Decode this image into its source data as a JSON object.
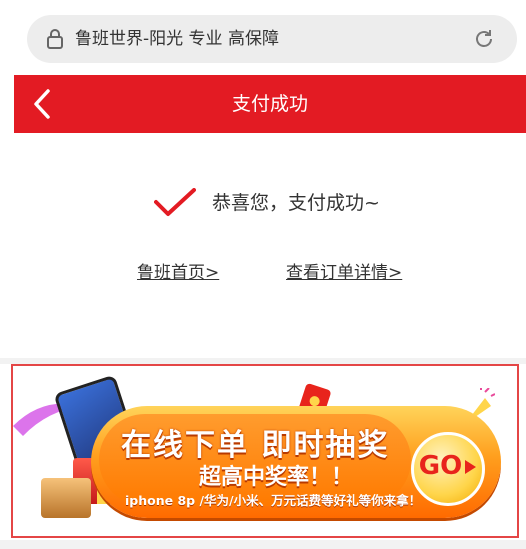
{
  "browser": {
    "url_text": "鲁班世界-阳光 专业 高保障"
  },
  "header": {
    "title": "支付成功"
  },
  "success": {
    "message": "恭喜您，支付成功~",
    "home_link": "鲁班首页>",
    "order_link": "查看订单详情>"
  },
  "banner": {
    "headline": "在线下单 即时抽奖",
    "subhead": "超高中奖率！！",
    "caption": "iphone 8p /华为/小米、万元话费等好礼等你来拿！",
    "go_label": "GO",
    "colors": {
      "primary": "#ff8a00",
      "accent": "#e31b23"
    }
  },
  "colors": {
    "header_bg": "#e31b23",
    "check": "#e31b23"
  },
  "icons": [
    "lock-icon",
    "reload-icon",
    "back-arrow-icon",
    "check-icon",
    "play-icon"
  ]
}
